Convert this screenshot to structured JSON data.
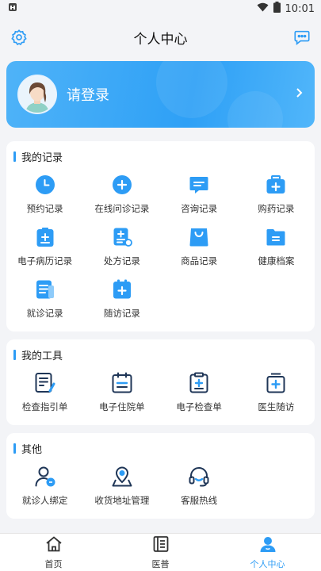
{
  "status": {
    "time": "10:01"
  },
  "header": {
    "title": "个人中心"
  },
  "login": {
    "text": "请登录"
  },
  "records": {
    "title": "我的记录",
    "items": [
      {
        "label": "预约记录",
        "icon": "clock-icon"
      },
      {
        "label": "在线问诊记录",
        "icon": "plus-circle-icon"
      },
      {
        "label": "咨询记录",
        "icon": "chat-icon"
      },
      {
        "label": "购药记录",
        "icon": "medicine-box-icon"
      },
      {
        "label": "电子病历记录",
        "icon": "medical-record-icon"
      },
      {
        "label": "处方记录",
        "icon": "prescription-icon"
      },
      {
        "label": "商品记录",
        "icon": "shopping-bag-icon"
      },
      {
        "label": "健康档案",
        "icon": "folder-icon"
      },
      {
        "label": "就诊记录",
        "icon": "visit-record-icon"
      },
      {
        "label": "随访记录",
        "icon": "follow-up-icon"
      }
    ]
  },
  "tools": {
    "title": "我的工具",
    "items": [
      {
        "label": "检查指引单",
        "icon": "guide-sheet-icon"
      },
      {
        "label": "电子住院单",
        "icon": "hospital-calendar-icon"
      },
      {
        "label": "电子检查单",
        "icon": "clipboard-icon"
      },
      {
        "label": "医生随访",
        "icon": "doctor-follow-icon"
      }
    ]
  },
  "others": {
    "title": "其他",
    "items": [
      {
        "label": "就诊人绑定",
        "icon": "patient-bind-icon"
      },
      {
        "label": "收货地址管理",
        "icon": "location-icon"
      },
      {
        "label": "客服热线",
        "icon": "headset-icon"
      }
    ]
  },
  "tabbar": {
    "items": [
      {
        "label": "首页",
        "icon": "home-icon"
      },
      {
        "label": "医普",
        "icon": "news-icon"
      },
      {
        "label": "个人中心",
        "icon": "user-icon"
      }
    ]
  },
  "colors": {
    "accent": "#2d9cf5",
    "background": "#f3f4f7"
  }
}
